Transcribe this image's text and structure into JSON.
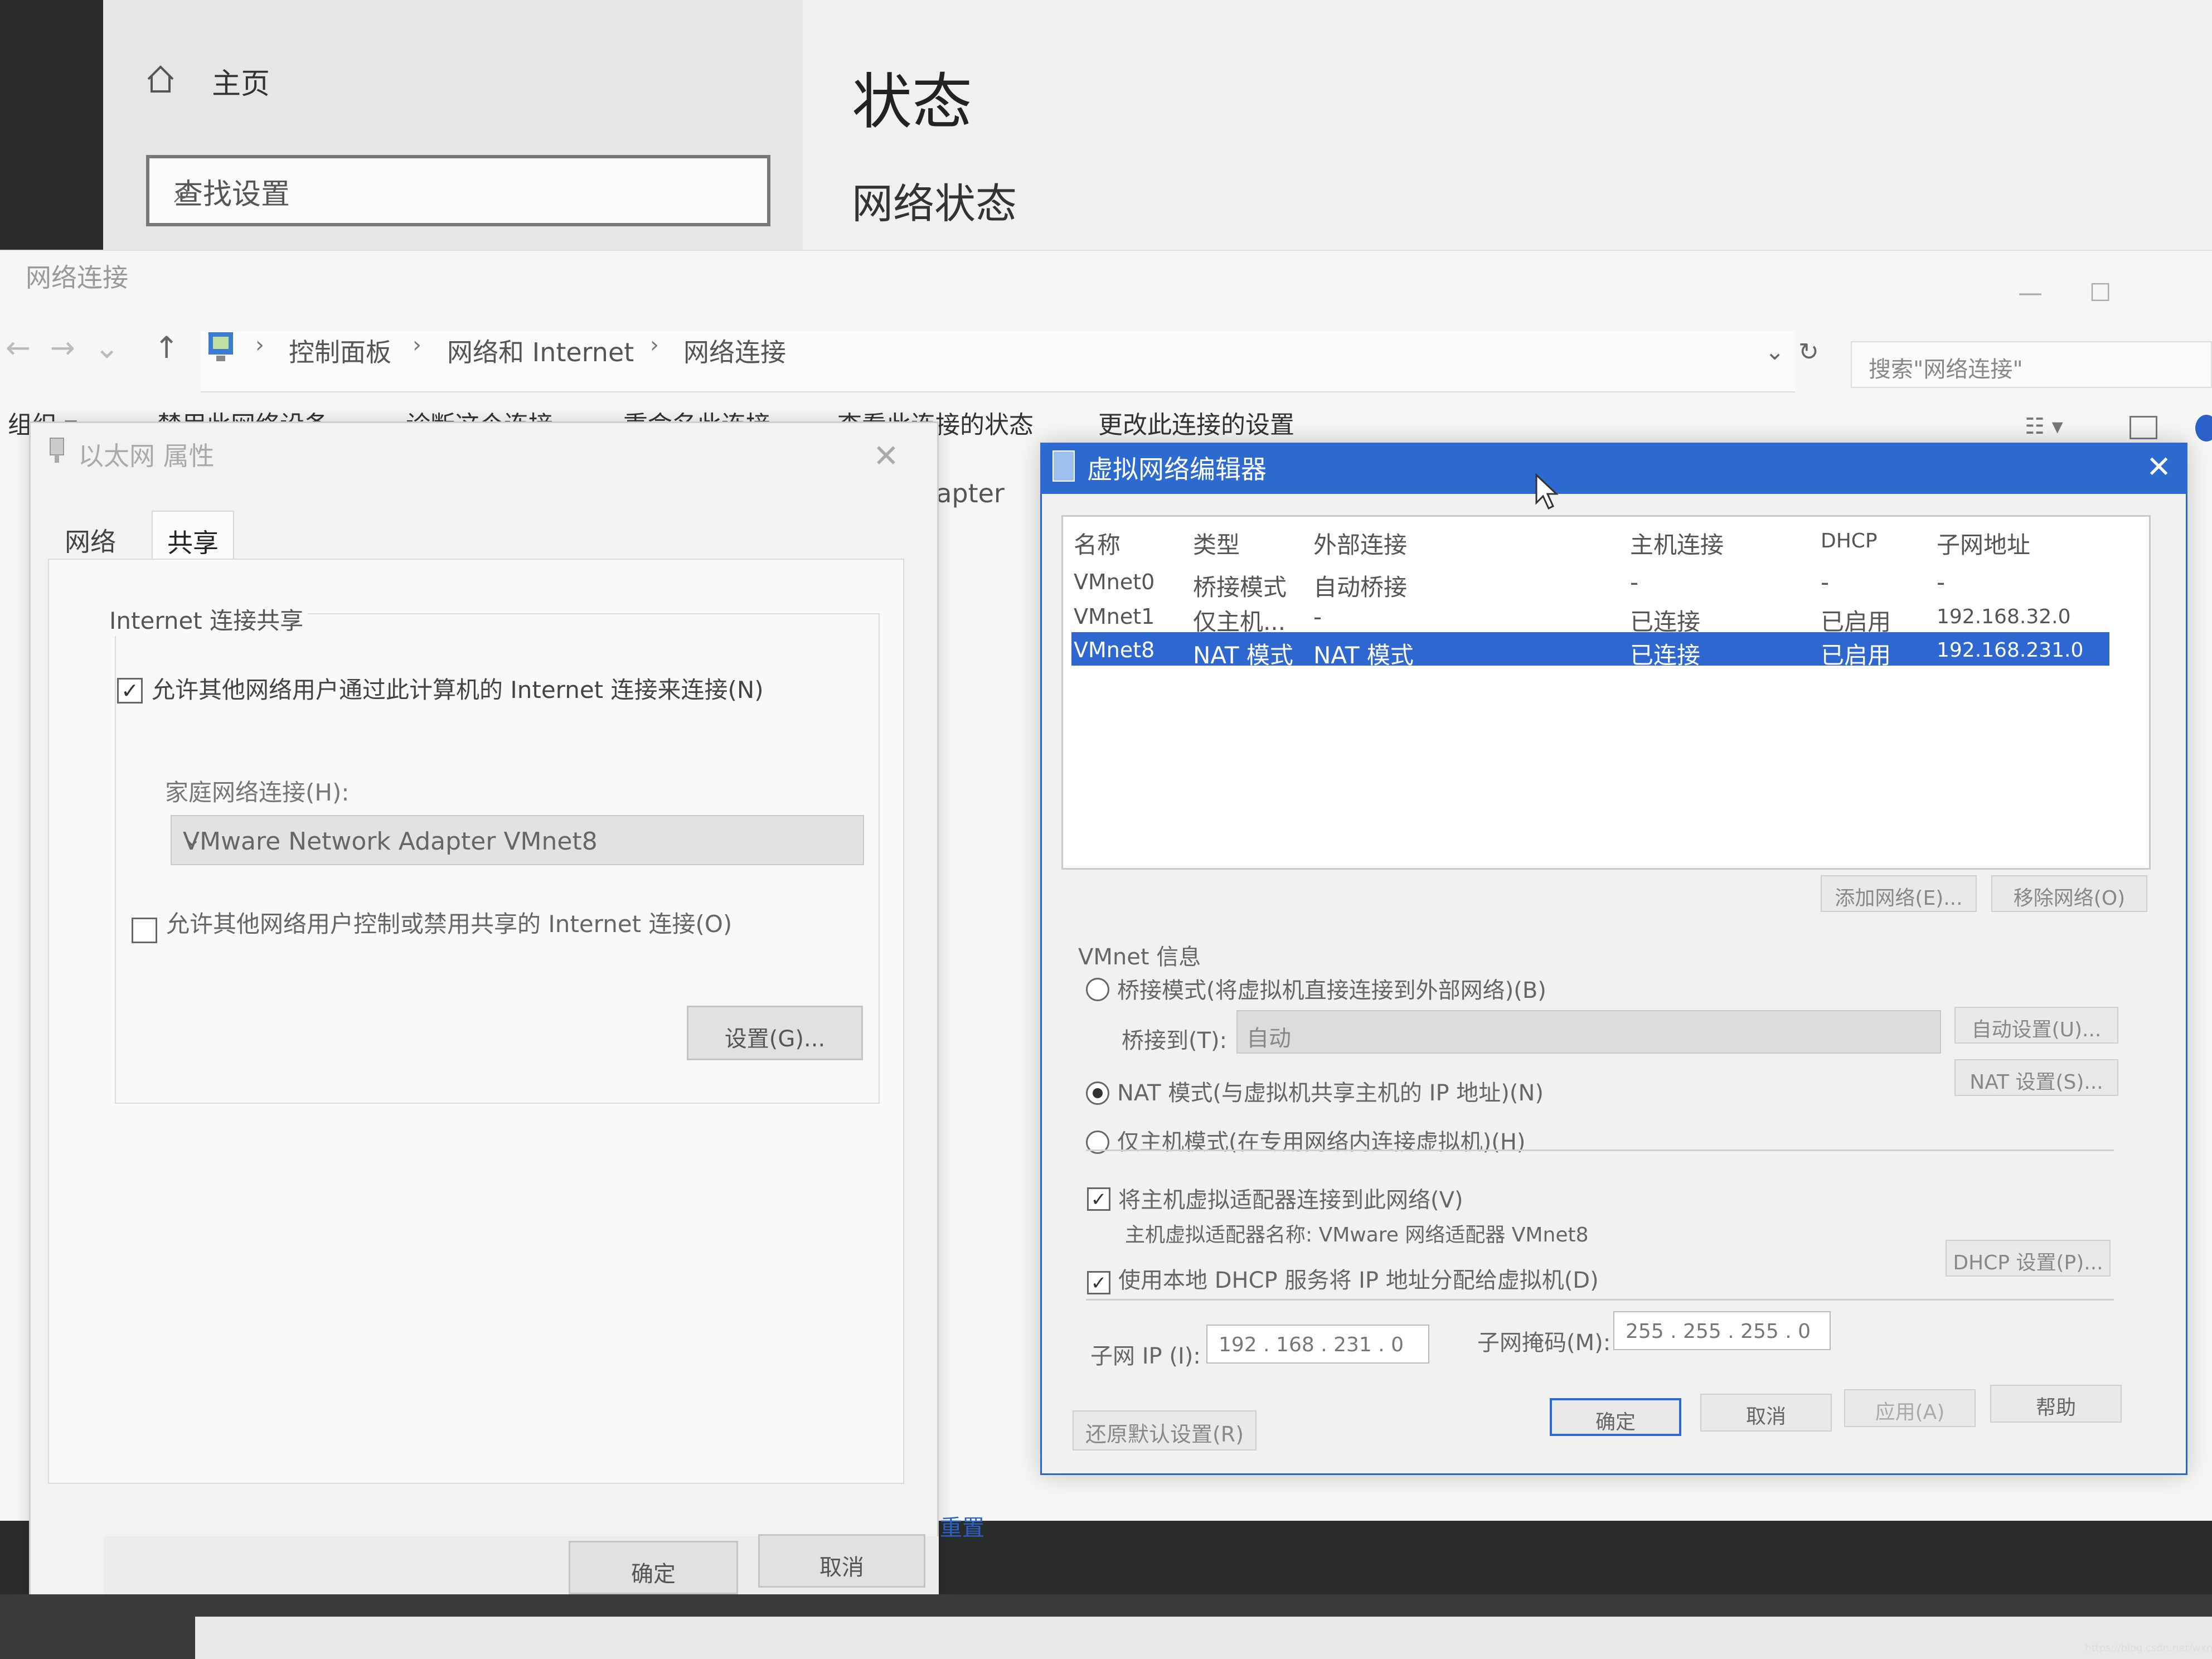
{
  "settings": {
    "home_label": "主页",
    "search_placeholder": "查找设置",
    "status_title": "状态",
    "network_status": "网络状态"
  },
  "network_connections": {
    "window_title": "网络连接",
    "breadcrumb": [
      "控制面板",
      "网络和 Internet",
      "网络连接"
    ],
    "search_placeholder": "搜索\"网络连接\"",
    "toolbar": [
      "组织 ▾",
      "禁用此网络设备",
      "诊断这个连接",
      "重命名此连接",
      "查看此连接的状态",
      "更改此连接的设置"
    ],
    "adapter_fragment": "dapter",
    "reset_link": "重置"
  },
  "ethernet_properties": {
    "title": "以太网 属性",
    "tabs": [
      "网络",
      "共享"
    ],
    "group_title": "Internet 连接共享",
    "allow_connect_label": "允许其他网络用户通过此计算机的 Internet 连接来连接(N)",
    "allow_connect_checked": true,
    "home_network_label": "家庭网络连接(H):",
    "home_network_value": "VMware Network Adapter VMnet8",
    "allow_control_label": "允许其他网络用户控制或禁用共享的 Internet 连接(O)",
    "allow_control_checked": false,
    "settings_button": "设置(G)...",
    "ok_button": "确定",
    "cancel_button": "取消"
  },
  "virtual_network_editor": {
    "title": "虚拟网络编辑器",
    "columns": [
      "名称",
      "类型",
      "外部连接",
      "主机连接",
      "DHCP",
      "子网地址"
    ],
    "rows": [
      [
        "VMnet0",
        "桥接模式",
        "自动桥接",
        "-",
        "-",
        "-"
      ],
      [
        "VMnet1",
        "仅主机...",
        "-",
        "已连接",
        "已启用",
        "192.168.32.0"
      ],
      [
        "VMnet8",
        "NAT 模式",
        "NAT 模式",
        "已连接",
        "已启用",
        "192.168.231.0"
      ]
    ],
    "selected_row": 2,
    "add_network_button": "添加网络(E)...",
    "remove_network_button": "移除网络(O)",
    "info_title": "VMnet 信息",
    "bridge_mode_label": "桥接模式(将虚拟机直接连接到外部网络)(B)",
    "bridge_to_label": "桥接到(T):",
    "bridge_to_value": "自动",
    "auto_settings_button": "自动设置(U)...",
    "nat_mode_label": "NAT 模式(与虚拟机共享主机的 IP 地址)(N)",
    "nat_settings_button": "NAT 设置(S)...",
    "host_only_label": "仅主机模式(在专用网络内连接虚拟机)(H)",
    "selected_mode": "nat",
    "connect_adapter_label": "将主机虚拟适配器连接到此网络(V)",
    "connect_adapter_checked": true,
    "adapter_name_label": "主机虚拟适配器名称: VMware 网络适配器 VMnet8",
    "use_dhcp_label": "使用本地 DHCP 服务将 IP 地址分配给虚拟机(D)",
    "use_dhcp_checked": true,
    "dhcp_settings_button": "DHCP 设置(P)...",
    "subnet_ip_label": "子网 IP (I):",
    "subnet_ip_value": "192 . 168 . 231 . 0",
    "subnet_mask_label": "子网掩码(M):",
    "subnet_mask_value": "255 . 255 . 255 . 0",
    "restore_defaults_button": "还原默认设置(R)",
    "ok_button": "确定",
    "cancel_button": "取消",
    "apply_button": "应用(A)",
    "help_button": "帮助"
  },
  "watermark": "https://blog.csdn.net/wxnshuai",
  "colors": {
    "accent_blue": "#2d6ad0",
    "selection_blue": "#2d67cf",
    "link_blue": "#2c62c8"
  }
}
